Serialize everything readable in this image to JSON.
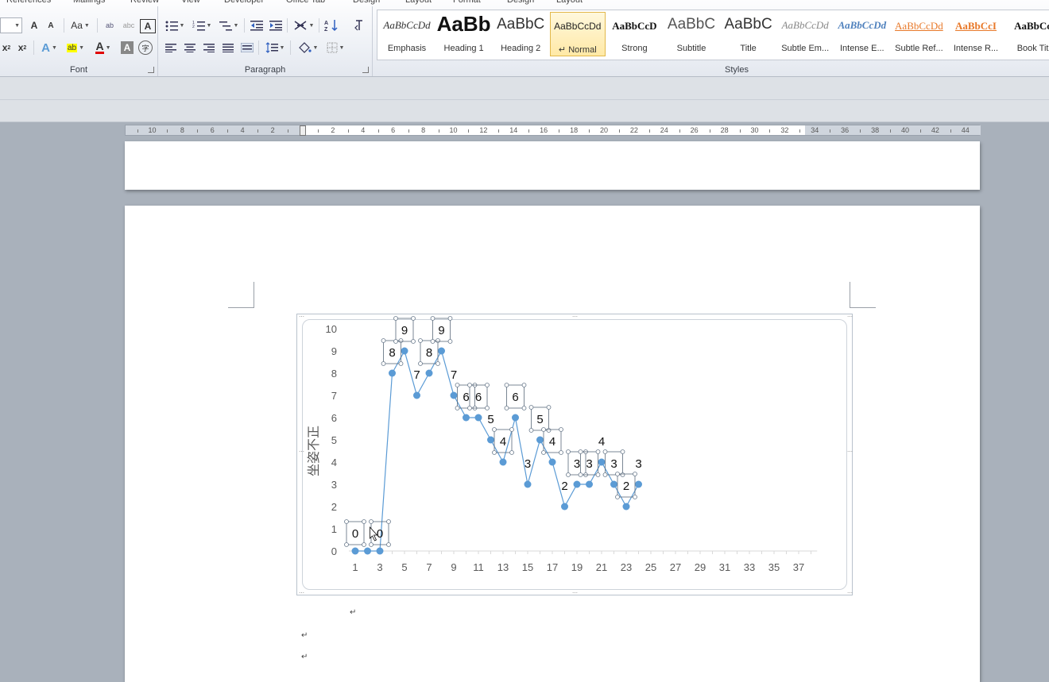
{
  "tabs": [
    "References",
    "Mailings",
    "Review",
    "View",
    "Developer",
    "Office Tab",
    "Design",
    "Layout",
    "Format",
    "Design",
    "Layout"
  ],
  "font_group": {
    "label": "Font",
    "buttons": {
      "grow": "A",
      "shrink": "A",
      "case": "Aa",
      "clear": "A",
      "abc1": "ab",
      "abc2": "abc",
      "charborder": "A",
      "sub": "x",
      "sup": "x",
      "effects": "A",
      "highlight": "ab",
      "fontcolor": "A",
      "shade": "A",
      "enclose": "字"
    }
  },
  "paragraph_group": {
    "label": "Paragraph"
  },
  "styles_group": {
    "label": "Styles",
    "items": [
      {
        "sample": "AaBbCcDd",
        "name": "Emphasis",
        "style": "italic",
        "color": "#333333"
      },
      {
        "sample": "AaBb",
        "name": "Heading 1",
        "style": "bold-large",
        "color": "#111111"
      },
      {
        "sample": "AaBbC",
        "name": "Heading 2",
        "style": "medium",
        "color": "#333333"
      },
      {
        "sample": "AaBbCcDd",
        "name": "↵ Normal",
        "style": "normal-small",
        "color": "#222222"
      },
      {
        "sample": "AaBbCcD",
        "name": "Strong",
        "style": "bold",
        "color": "#111111"
      },
      {
        "sample": "AaBbC",
        "name": "Subtitle",
        "style": "medium",
        "color": "#555555"
      },
      {
        "sample": "AaBbC",
        "name": "Title",
        "style": "medium",
        "color": "#333333"
      },
      {
        "sample": "AaBbCcDd",
        "name": "Subtle Em...",
        "style": "italic",
        "color": "#888888"
      },
      {
        "sample": "AaBbCcDd",
        "name": "Intense E...",
        "style": "bold-italic",
        "color": "#4f81bd"
      },
      {
        "sample": "AaBbCcDd",
        "name": "Subtle Ref...",
        "style": "underline",
        "color": "#e8792a"
      },
      {
        "sample": "AaBbCcI",
        "name": "Intense R...",
        "style": "bold-underline",
        "color": "#e8792a"
      },
      {
        "sample": "AaBbCc",
        "name": "Book Tit",
        "style": "bold",
        "color": "#111111"
      }
    ],
    "selected_index": 3
  },
  "ruler": {
    "labels": [
      "10",
      "8",
      "6",
      "4",
      "2",
      "2",
      "4",
      "6",
      "8",
      "10",
      "12",
      "14",
      "16",
      "18",
      "20",
      "22",
      "24",
      "26",
      "28",
      "30",
      "32",
      "34",
      "36",
      "38",
      "40",
      "42",
      "44"
    ]
  },
  "chart_data": {
    "type": "line",
    "ylabel": "坐姿不正",
    "ylim": [
      0,
      10
    ],
    "yticks": [
      0,
      1,
      2,
      3,
      4,
      5,
      6,
      7,
      8,
      9,
      10
    ],
    "xticks": [
      1,
      3,
      5,
      7,
      9,
      11,
      13,
      15,
      17,
      19,
      21,
      23,
      25,
      27,
      29,
      31,
      33,
      35,
      37
    ],
    "x": [
      1,
      2,
      3,
      4,
      5,
      6,
      7,
      8,
      9,
      10,
      11,
      12,
      13,
      14,
      15,
      16,
      17,
      18,
      19,
      20,
      21,
      22,
      23,
      24
    ],
    "values": [
      0,
      0,
      0,
      8,
      9,
      7,
      8,
      9,
      7,
      6,
      6,
      5,
      4,
      6,
      3,
      5,
      4,
      2,
      3,
      3,
      4,
      3,
      2,
      3
    ],
    "data_labels": [
      "0",
      "",
      "0",
      "8",
      "9",
      "7",
      "8",
      "9",
      "7",
      "6",
      "6",
      "5",
      "4",
      "6",
      "3",
      "5",
      "4",
      "2",
      "3",
      "3",
      "4",
      "3",
      "2",
      "3"
    ],
    "series_color": "#5b9bd5",
    "grid": false
  },
  "paragraph_marks": [
    "↵",
    "↵",
    "↵"
  ]
}
